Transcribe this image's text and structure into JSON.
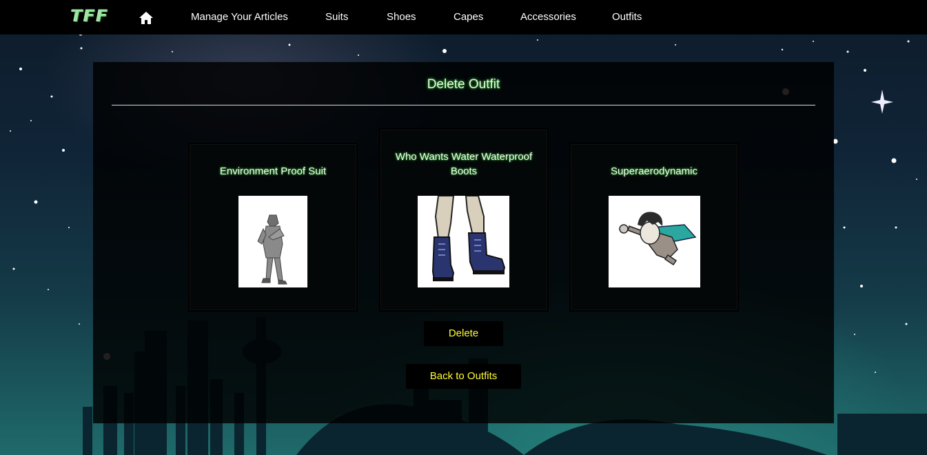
{
  "nav": {
    "brand": "TFF",
    "items": [
      "Manage Your Articles",
      "Suits",
      "Shoes",
      "Capes",
      "Accessories",
      "Outfits"
    ]
  },
  "page": {
    "title": "Delete Outfit"
  },
  "outfit": {
    "items": [
      {
        "name": "Environment Proof Suit",
        "image": "suit-figure"
      },
      {
        "name": "Who Wants Water Waterproof Boots",
        "image": "boots"
      },
      {
        "name": "Superaerodynamic",
        "image": "flying-cape-figure"
      }
    ]
  },
  "actions": {
    "delete_label": "Delete",
    "back_label": "Back to Outfits"
  },
  "colors": {
    "nav_bg": "#000000",
    "title_glow": "#4dff55",
    "button_text": "#ffff33"
  }
}
